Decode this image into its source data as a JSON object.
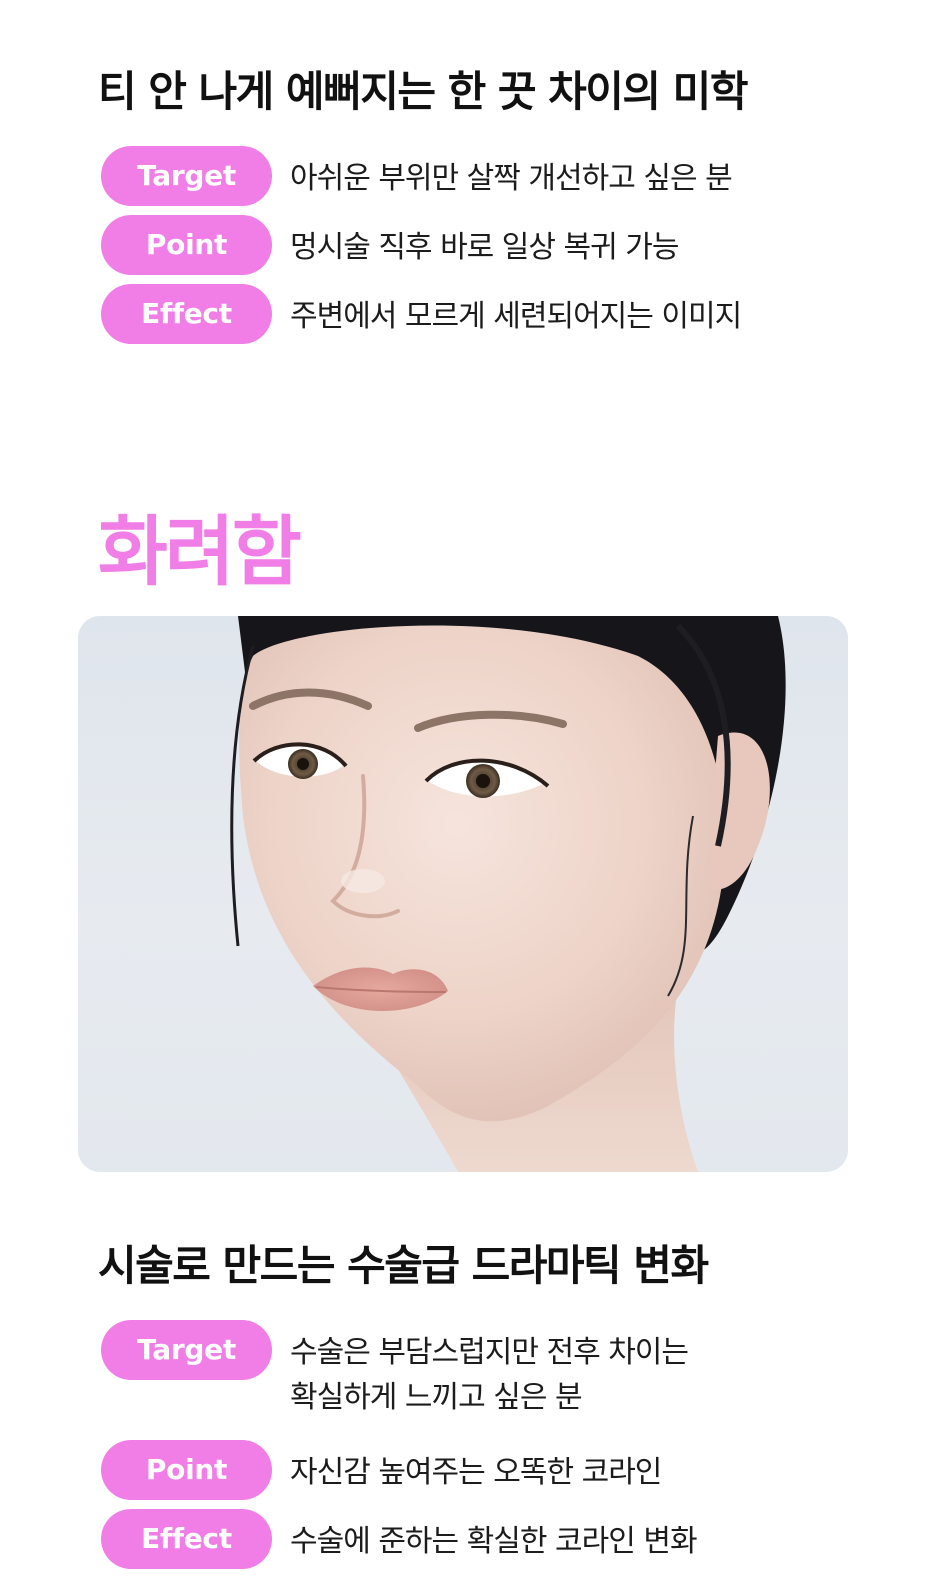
{
  "sections": [
    {
      "title": "티 안 나게 예뻐지는 한 끗 차이의 미학",
      "features": [
        {
          "label": "Target",
          "text": "아쉬운 부위만 살짝 개선하고 싶은 분"
        },
        {
          "label": "Point",
          "text": "멍시술 직후 바로 일상 복귀 가능"
        },
        {
          "label": "Effect",
          "text": "주변에서 모르게 세련되어지는 이미지"
        }
      ]
    },
    {
      "heading": "화려함",
      "title": "시술로 만드는 수술급 드라마틱 변화",
      "features": [
        {
          "label": "Target",
          "text_line1": "수술은 부담스럽지만 전후 차이는",
          "text_line2": "확실하게 느끼고 싶은 분"
        },
        {
          "label": "Point",
          "text": "자신감 높여주는 오똑한 코라인"
        },
        {
          "label": "Effect",
          "text": "수술에 준하는 확실한 코라인 변화"
        }
      ]
    }
  ],
  "colors": {
    "accent": "#f07ee6",
    "text": "#1c1c1c",
    "heading": "#111111",
    "background": "#ffffff"
  }
}
